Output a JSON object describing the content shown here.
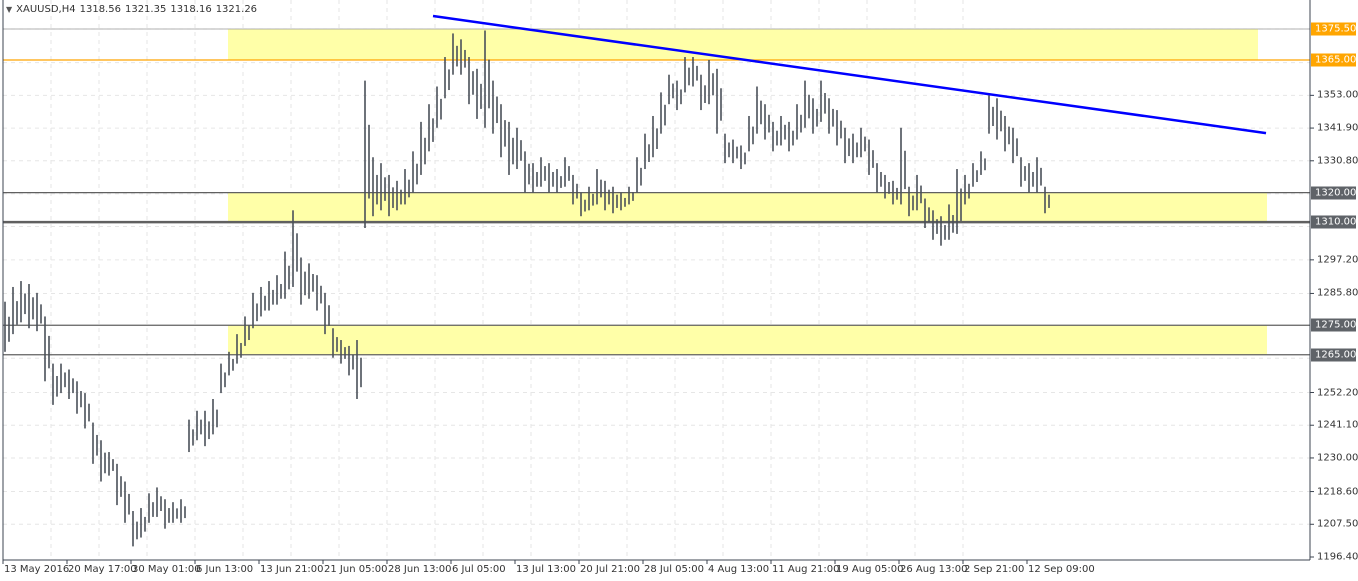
{
  "header": {
    "symbol": "XAUUSD,H4",
    "open": "1318.56",
    "high": "1321.35",
    "low": "1318.16",
    "close": "1321.26"
  },
  "colors": {
    "bars": "#4a5059",
    "zone": "#ffffa8",
    "trendline": "#0000ff",
    "resistance_line": "#ffa500",
    "level_line": "#606060",
    "grid": "#e6e6e6"
  },
  "chart_data": {
    "type": "ohlc-bars",
    "title": "XAUUSD,H4",
    "ylim": [
      1196.4,
      1375.5
    ],
    "grid": true,
    "y_ticks": [
      "1353.00",
      "1341.90",
      "1330.80",
      "1297.20",
      "1285.80",
      "1252.20",
      "1241.10",
      "1230.00",
      "1218.60",
      "1207.50",
      "1196.40"
    ],
    "x_ticks": [
      "13 May 2016",
      "20 May 17:00",
      "30 May 01:00",
      "6 Jun 13:00",
      "13 Jun 21:00",
      "21 Jun 05:00",
      "28 Jun 13:00",
      "6 Jul 05:00",
      "13 Jul 13:00",
      "20 Jul 21:00",
      "28 Jul 05:00",
      "4 Aug 13:00",
      "11 Aug 21:00",
      "19 Aug 05:00",
      "26 Aug 13:00",
      "2 Sep 21:00",
      "12 Sep 09:00"
    ],
    "bars_high_low": [
      [
        1283,
        1266
      ],
      [
        1288,
        1272
      ],
      [
        1290,
        1276
      ],
      [
        1289,
        1274
      ],
      [
        1286,
        1273
      ],
      [
        1278,
        1256
      ],
      [
        1262,
        1248
      ],
      [
        1262,
        1252
      ],
      [
        1260,
        1250
      ],
      [
        1256,
        1245
      ],
      [
        1252,
        1240
      ],
      [
        1242,
        1228
      ],
      [
        1236,
        1222
      ],
      [
        1232,
        1224
      ],
      [
        1228,
        1214
      ],
      [
        1222,
        1208
      ],
      [
        1212,
        1200
      ],
      [
        1213,
        1203
      ],
      [
        1218,
        1208
      ],
      [
        1220,
        1210
      ],
      [
        1216,
        1206
      ],
      [
        1215,
        1208
      ],
      [
        1216,
        1208
      ],
      [
        1243,
        1232
      ],
      [
        1246,
        1236
      ],
      [
        1246,
        1234
      ],
      [
        1250,
        1238
      ],
      [
        1262,
        1252
      ],
      [
        1266,
        1258
      ],
      [
        1272,
        1262
      ],
      [
        1278,
        1268
      ],
      [
        1286,
        1274
      ],
      [
        1288,
        1278
      ],
      [
        1290,
        1280
      ],
      [
        1292,
        1282
      ],
      [
        1300,
        1284
      ],
      [
        1314,
        1288
      ],
      [
        1298,
        1282
      ],
      [
        1296,
        1284
      ],
      [
        1292,
        1280
      ],
      [
        1286,
        1272
      ],
      [
        1274,
        1264
      ],
      [
        1270,
        1262
      ],
      [
        1268,
        1258
      ],
      [
        1270,
        1250
      ],
      [
        1358,
        1308
      ],
      [
        1332,
        1312
      ],
      [
        1330,
        1314
      ],
      [
        1326,
        1312
      ],
      [
        1324,
        1314
      ],
      [
        1328,
        1316
      ],
      [
        1334,
        1320
      ],
      [
        1344,
        1326
      ],
      [
        1350,
        1334
      ],
      [
        1356,
        1342
      ],
      [
        1366,
        1352
      ],
      [
        1374,
        1360
      ],
      [
        1372,
        1360
      ],
      [
        1366,
        1350
      ],
      [
        1362,
        1345
      ],
      [
        1375,
        1342
      ],
      [
        1358,
        1340
      ],
      [
        1350,
        1332
      ],
      [
        1344,
        1326
      ],
      [
        1342,
        1328
      ],
      [
        1334,
        1320
      ],
      [
        1330,
        1320
      ],
      [
        1332,
        1322
      ],
      [
        1330,
        1320
      ],
      [
        1328,
        1320
      ],
      [
        1332,
        1322
      ],
      [
        1326,
        1316
      ],
      [
        1320,
        1312
      ],
      [
        1322,
        1314
      ],
      [
        1328,
        1316
      ],
      [
        1324,
        1314
      ],
      [
        1322,
        1313
      ],
      [
        1320,
        1314
      ],
      [
        1322,
        1316
      ],
      [
        1332,
        1320
      ],
      [
        1340,
        1328
      ],
      [
        1346,
        1332
      ],
      [
        1354,
        1340
      ],
      [
        1360,
        1350
      ],
      [
        1358,
        1348
      ],
      [
        1366,
        1354
      ],
      [
        1366,
        1356
      ],
      [
        1360,
        1348
      ],
      [
        1365,
        1350
      ],
      [
        1362,
        1340
      ],
      [
        1340,
        1330
      ],
      [
        1338,
        1330
      ],
      [
        1336,
        1328
      ],
      [
        1346,
        1334
      ],
      [
        1356,
        1340
      ],
      [
        1350,
        1338
      ],
      [
        1344,
        1334
      ],
      [
        1346,
        1336
      ],
      [
        1344,
        1334
      ],
      [
        1350,
        1338
      ],
      [
        1358,
        1342
      ],
      [
        1352,
        1340
      ],
      [
        1358,
        1344
      ],
      [
        1352,
        1340
      ],
      [
        1348,
        1336
      ],
      [
        1342,
        1330
      ],
      [
        1340,
        1330
      ],
      [
        1342,
        1332
      ],
      [
        1338,
        1326
      ],
      [
        1330,
        1320
      ],
      [
        1326,
        1318
      ],
      [
        1324,
        1316
      ],
      [
        1342,
        1316
      ],
      [
        1322,
        1312
      ],
      [
        1326,
        1314
      ],
      [
        1318,
        1308
      ],
      [
        1314,
        1304
      ],
      [
        1312,
        1302
      ],
      [
        1316,
        1304
      ],
      [
        1328,
        1306
      ],
      [
        1326,
        1316
      ],
      [
        1330,
        1322
      ],
      [
        1334,
        1326
      ],
      [
        1353,
        1340
      ],
      [
        1352,
        1338
      ],
      [
        1346,
        1334
      ],
      [
        1342,
        1330
      ],
      [
        1332,
        1322
      ],
      [
        1330,
        1320
      ],
      [
        1332,
        1320
      ],
      [
        1322,
        1313
      ]
    ],
    "zones": [
      [
        1365.0,
        1375.5
      ],
      [
        1310.0,
        1320.0
      ],
      [
        1265.0,
        1275.0
      ]
    ],
    "levels": [
      {
        "label": "1375.50",
        "price": 1375.5,
        "style": "orange"
      },
      {
        "label": "1365.00",
        "price": 1365.0,
        "style": "orange"
      },
      {
        "label": "1320.00",
        "price": 1320.0,
        "style": "gray"
      },
      {
        "label": "1310.00",
        "price": 1310.0,
        "style": "gray"
      },
      {
        "label": "1275.00",
        "price": 1275.0,
        "style": "gray"
      },
      {
        "label": "1265.00",
        "price": 1265.0,
        "style": "gray"
      }
    ],
    "trendline": {
      "start_price": 1379.9,
      "end_price": 1340.2
    }
  }
}
